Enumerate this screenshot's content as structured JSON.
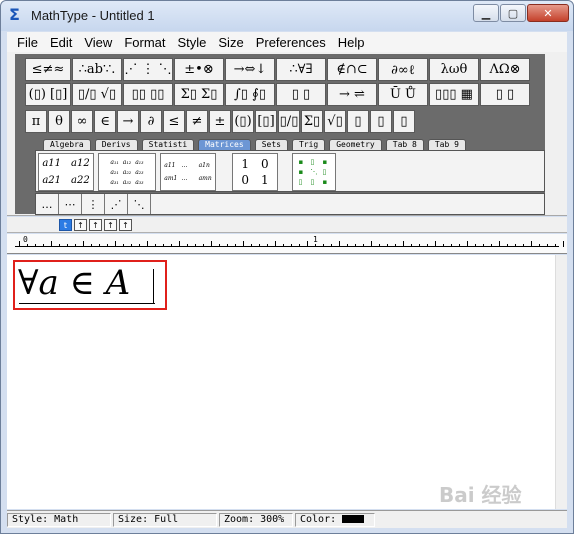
{
  "window": {
    "title": "MathType - Untitled 1",
    "app_icon": "Σ"
  },
  "title_buttons": {
    "minimize": "▁",
    "maximize": "▢",
    "close": "✕"
  },
  "menu": [
    "File",
    "Edit",
    "View",
    "Format",
    "Style",
    "Size",
    "Preferences",
    "Help"
  ],
  "palette_row1": [
    "≤≠≈",
    "∴ab∵.",
    "⋰ ⋮ ⋱",
    "±•⊗",
    "→⇔↓",
    "∴∀∃",
    "∉∩⊂",
    "∂∞ℓ",
    "λωθ",
    "ΛΩ⊗"
  ],
  "palette_row2": [
    "(▯) [▯]",
    "▯/▯ √▯",
    "▯▯ ▯▯",
    "Σ▯ Σ▯",
    "∫▯ ∮▯",
    "▯ ▯",
    "→ ⇌",
    "Ū Ů",
    "▯▯▯ ▦",
    "▯ ▯"
  ],
  "palette_row3": [
    "π",
    "θ",
    "∞",
    "∈",
    "→",
    "∂",
    "≤",
    "≠",
    "±",
    "(▯)",
    "[▯]",
    "▯/▯",
    "Σ▯",
    "√▯",
    "▯",
    "▯",
    "▯"
  ],
  "tabs": [
    "Algebra",
    "Derivs",
    "Statisti",
    "Matrices",
    "Sets",
    "Trig",
    "Geometry",
    "Tab 8",
    "Tab 9"
  ],
  "active_tab": "Matrices",
  "matrix_templates": {
    "m1": [
      "a11",
      "a12",
      "a21",
      "a22"
    ],
    "m3": [
      "a11",
      "…",
      "a1n",
      "am1",
      "…",
      "amn"
    ],
    "m4": [
      "1",
      "0",
      "0",
      "1"
    ]
  },
  "dots_row": [
    "…",
    "⋯",
    "⋮",
    "⋰",
    "⋱"
  ],
  "nav_buttons": [
    "t",
    "↑",
    "↑",
    "↑",
    "↑"
  ],
  "ruler": {
    "marks": [
      "0",
      "1"
    ]
  },
  "formula": "∀a ∈ A",
  "watermark": "Bai 经验",
  "status": {
    "style": "Style: Math",
    "size": "Size: Full",
    "zoom": "Zoom: 300%",
    "color_label": "Color:",
    "color_value": "#000000"
  }
}
